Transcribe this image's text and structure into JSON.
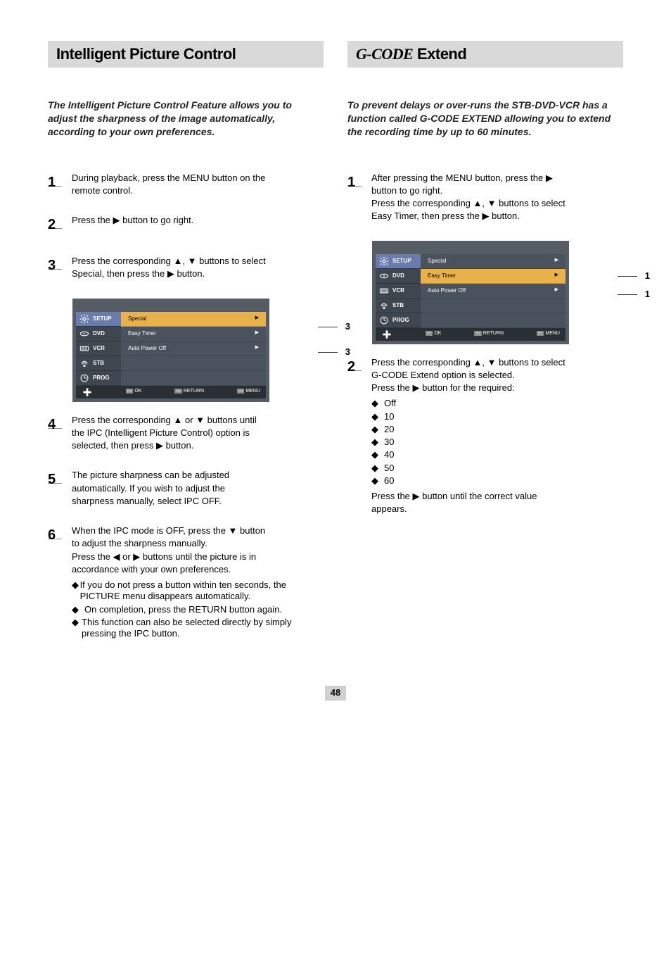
{
  "left": {
    "header_title": "Intelligent Picture Control",
    "intro_note": "The Intelligent Picture Control Feature allows you to adjust the sharpness of the image automatically, according to your own preferences.",
    "step1_num": "1",
    "step1_line1": "During playback, press the MENU button on the",
    "step1_line2": "remote control.",
    "step2_num": "2",
    "step2_line1": "Press the ▶ button to go right.",
    "step3_num": "3",
    "step3_line1": "Press the corresponding ▲, ▼ buttons to select",
    "step3_line2": "Special, then press the ▶ button.",
    "step4_num": "4",
    "step4_line1": "Press the corresponding ▲ or ▼ buttons until",
    "step4_line2": "the IPC (Intelligent Picture Control) option is",
    "step4_line3": "selected, then press ▶ button.",
    "step5_num": "5",
    "step5_line1": "The picture sharpness can be adjusted",
    "step5_line2": "automatically. If you wish to adjust the",
    "step5_line3": "sharpness manually, select IPC OFF.",
    "step6_num": "6",
    "step6_line1": "When the IPC mode is OFF, press the ▼ button",
    "step6_line2": "to adjust the sharpness manually.",
    "step6_line3": "Press the ◀ or ▶ buttons until the picture is in",
    "step6_line4": "accordance with your own preferences.",
    "sublist": [
      {
        "b": "If you do not press a button within ten seconds, the PICTURE menu disappears automatically."
      },
      {
        "b": "On completion, press the RETURN button again."
      },
      {
        "b": "This function can also be selected directly by simply pressing the IPC button."
      }
    ],
    "osd": {
      "side": [
        "SETUP",
        "DVD",
        "VCR",
        "STB",
        "PROG"
      ],
      "main_rows": [
        {
          "l": "Special",
          "r": "▶",
          "hl": true
        },
        {
          "l": "Easy Timer",
          "r": "▶"
        },
        {
          "l": "Auto Power Off",
          "r": "▶"
        }
      ],
      "foot": [
        "OK",
        "RETURN",
        "MENU"
      ],
      "callouts": [
        "3",
        "3"
      ]
    }
  },
  "right": {
    "header_title_strong": "G-CODE",
    "header_title_rest": " Extend",
    "intro_note": "To prevent delays or over-runs the STB-DVD-VCR has a function called G-CODE EXTEND allowing you to extend the recording time by up to 60 minutes.",
    "step1_num": "1",
    "step1_line1": "After pressing the MENU button, press the ▶",
    "step1_line2": "button to go right.",
    "step1_line3": "Press the corresponding ▲, ▼ buttons to select",
    "step1_line4": "Easy Timer, then press the ▶ button.",
    "step2_num": "2",
    "step2_line1": "Press the corresponding ▲, ▼ buttons to select",
    "step2_line2": "G-CODE Extend option is selected.",
    "step2_line3": "Press the ▶ button for the required:",
    "step2_sub": [
      "Off",
      "10",
      "20",
      "30",
      "40",
      "50",
      "60"
    ],
    "step2_line_last1_a": "Press the ",
    "step2_line_last1_b": "▶",
    "step2_line_last1_c": " button until the correct value",
    "step2_line_last2": "appears.",
    "osd": {
      "side": [
        "SETUP",
        "DVD",
        "VCR",
        "STB",
        "PROG"
      ],
      "main_rows": [
        {
          "l": "Special",
          "r": "▶"
        },
        {
          "l": "Easy Timer",
          "r": "▶",
          "hl": true
        },
        {
          "l": "Auto Power Off",
          "r": "▶"
        }
      ],
      "foot": [
        "OK",
        "RETURN",
        "MENU"
      ],
      "callouts": [
        "1",
        "1"
      ]
    }
  },
  "page_number": "48",
  "icons": {
    "gear": "gear-icon",
    "dvd": "dvd-icon",
    "vcr": "vcr-icon",
    "stb": "stb-icon",
    "prog": "clock-icon",
    "cross": "dpad-icon",
    "ok": "ok-icon",
    "return": "return-icon",
    "menu": "menu-icon"
  }
}
